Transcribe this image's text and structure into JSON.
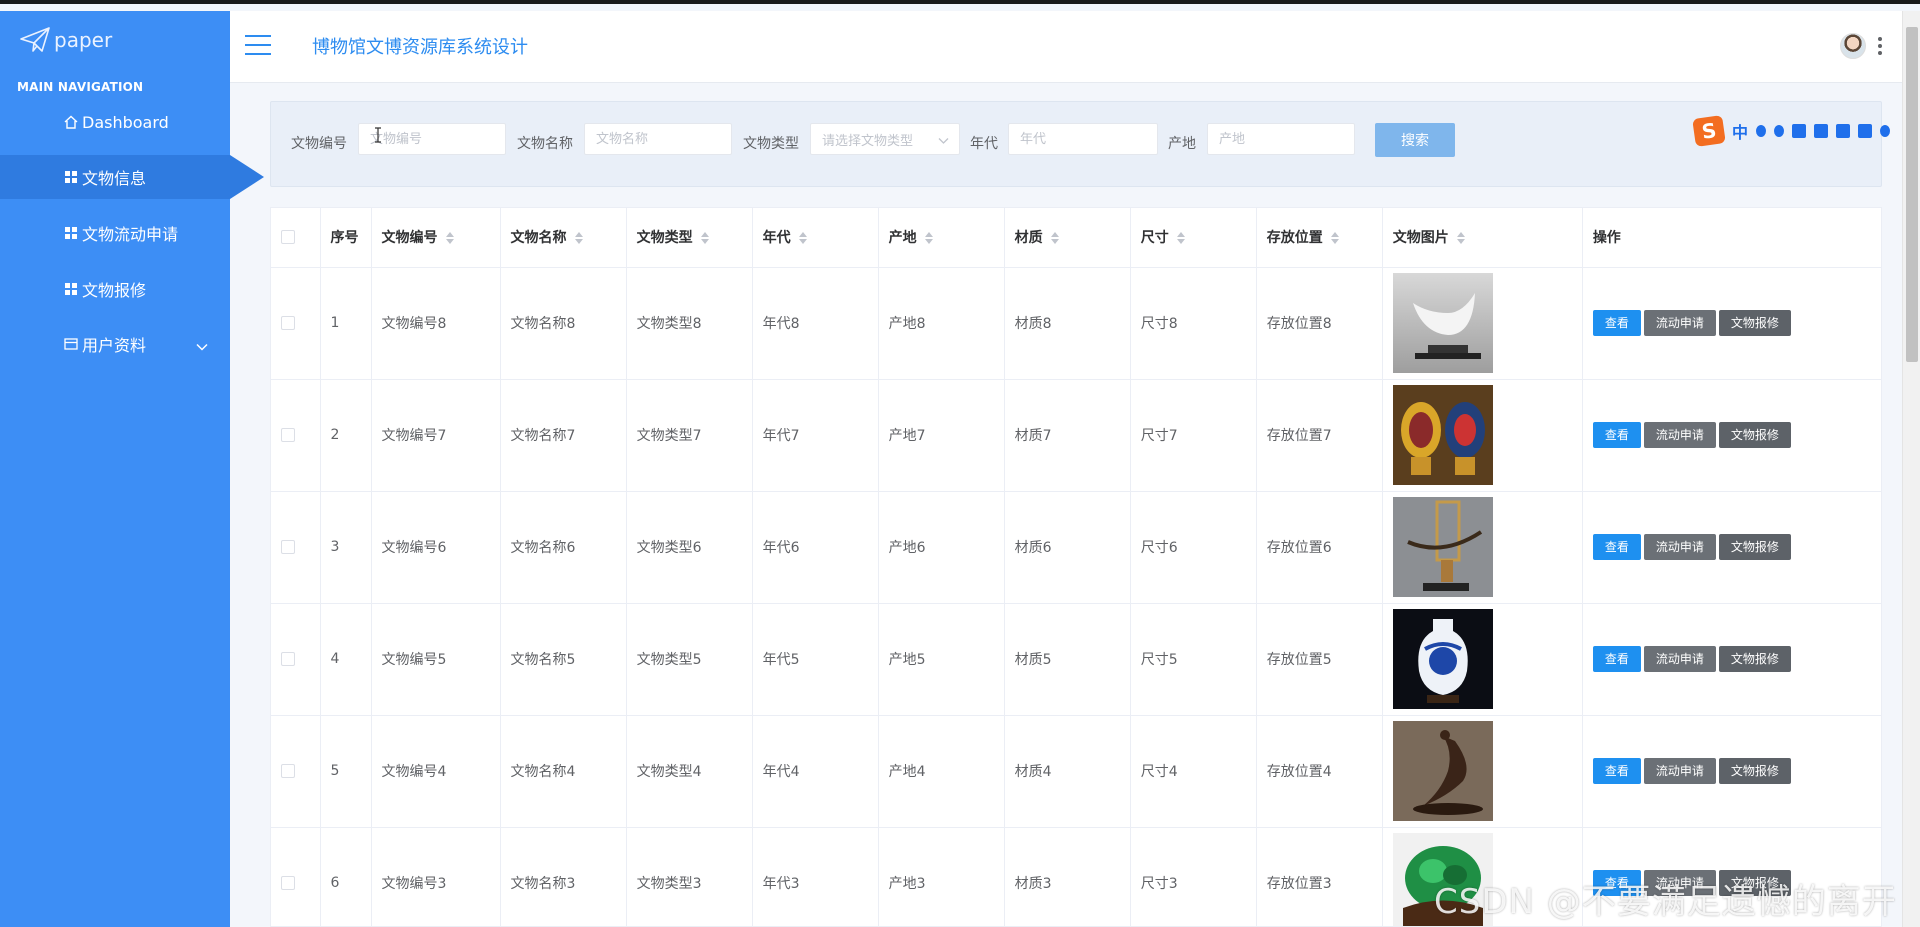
{
  "app": {
    "logo_text": "paper",
    "title": "博物馆文博资源库系统设计"
  },
  "sidebar": {
    "section_title": "MAIN NAVIGATION",
    "items": [
      {
        "label": "Dashboard",
        "icon": "home-icon",
        "active": false
      },
      {
        "label": "文物信息",
        "icon": "grid-icon",
        "active": true
      },
      {
        "label": "文物流动申请",
        "icon": "grid-icon",
        "active": false
      },
      {
        "label": "文物报修",
        "icon": "grid-icon",
        "active": false
      },
      {
        "label": "用户资料",
        "icon": "card-icon",
        "active": false,
        "has_submenu": true
      }
    ]
  },
  "search": {
    "fields": [
      {
        "label": "文物编号",
        "placeholder": "文物编号",
        "value": ""
      },
      {
        "label": "文物名称",
        "placeholder": "文物名称",
        "value": ""
      },
      {
        "label": "文物类型",
        "placeholder": "请选择文物类型",
        "type": "select"
      },
      {
        "label": "年代",
        "placeholder": "年代",
        "value": ""
      },
      {
        "label": "产地",
        "placeholder": "产地",
        "value": ""
      }
    ],
    "button_label": "搜索"
  },
  "ime_toolbar": {
    "logo": "S",
    "mode": "中"
  },
  "table": {
    "columns": [
      "序号",
      "文物编号",
      "文物名称",
      "文物类型",
      "年代",
      "产地",
      "材质",
      "尺寸",
      "存放位置",
      "文物图片",
      "操作"
    ],
    "actions": {
      "view": "查看",
      "flow": "流动申请",
      "repair": "文物报修"
    },
    "rows": [
      {
        "index": "1",
        "code": "文物编号8",
        "name": "文物名称8",
        "type": "文物类型8",
        "era": "年代8",
        "origin": "产地8",
        "material": "材质8",
        "size": "尺寸8",
        "location": "存放位置8",
        "image": "white-porcelain-sculpture"
      },
      {
        "index": "2",
        "code": "文物编号7",
        "name": "文物名称7",
        "type": "文物类型7",
        "era": "年代7",
        "origin": "产地7",
        "material": "材质7",
        "size": "尺寸7",
        "location": "存放位置7",
        "image": "cloisonne-vases"
      },
      {
        "index": "3",
        "code": "文物编号6",
        "name": "文物名称6",
        "type": "文物类型6",
        "era": "年代6",
        "origin": "产地6",
        "material": "材质6",
        "size": "尺寸6",
        "location": "存放位置6",
        "image": "bronze-stand-ornament"
      },
      {
        "index": "4",
        "code": "文物编号5",
        "name": "文物名称5",
        "type": "文物类型5",
        "era": "年代5",
        "origin": "产地5",
        "material": "材质5",
        "size": "尺寸5",
        "location": "存放位置5",
        "image": "blue-white-vase"
      },
      {
        "index": "5",
        "code": "文物编号4",
        "name": "文物名称4",
        "type": "文物类型4",
        "era": "年代4",
        "origin": "产地4",
        "material": "材质4",
        "size": "尺寸4",
        "location": "存放位置4",
        "image": "wooden-crane-carving"
      },
      {
        "index": "6",
        "code": "文物编号3",
        "name": "文物名称3",
        "type": "文物类型3",
        "era": "年代3",
        "origin": "产地3",
        "material": "材质3",
        "size": "尺寸3",
        "location": "存放位置3",
        "image": "jade-cabbage"
      }
    ]
  },
  "watermark": "CSDN @不要满足遗憾的离开",
  "colors": {
    "sidebar": "#3d8ef5",
    "sidebar_active": "#2f7be0",
    "primary": "#2d8cf0",
    "view_button": "#1e90f0",
    "action_button": "#6b7076"
  }
}
